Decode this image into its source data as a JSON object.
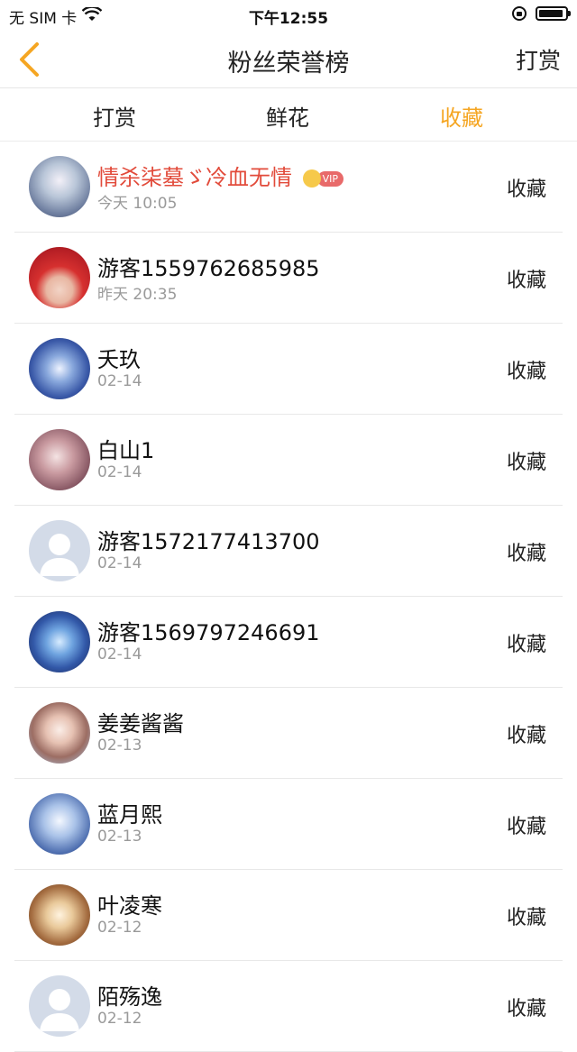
{
  "status": {
    "carrier": "无 SIM 卡",
    "time": "下午12:55"
  },
  "nav": {
    "title": "粉丝荣誉榜",
    "right": "打赏"
  },
  "tabs": [
    {
      "label": "打赏"
    },
    {
      "label": "鲜花"
    },
    {
      "label": "收藏"
    }
  ],
  "colors": {
    "accent": "#f5a623",
    "vip_name": "#e24b3b"
  },
  "rows": [
    {
      "name": "情杀柒墓ゞ冷血无情",
      "vip_label": "VIP",
      "time": "今天 10:05",
      "action": "收藏"
    },
    {
      "name": "游客1559762685985",
      "time": "昨天 20:35",
      "action": "收藏"
    },
    {
      "name": "夭玖",
      "time": "02-14",
      "action": "收藏"
    },
    {
      "name": "白山1",
      "time": "02-14",
      "action": "收藏"
    },
    {
      "name": "游客1572177413700",
      "time": "02-14",
      "action": "收藏"
    },
    {
      "name": "游客1569797246691",
      "time": "02-14",
      "action": "收藏"
    },
    {
      "name": "姜姜酱酱",
      "time": "02-13",
      "action": "收藏"
    },
    {
      "name": "蓝月熙",
      "time": "02-13",
      "action": "收藏"
    },
    {
      "name": "叶凌寒",
      "time": "02-12",
      "action": "收藏"
    },
    {
      "name": "陌殇逸",
      "time": "02-12",
      "action": "收藏"
    }
  ]
}
